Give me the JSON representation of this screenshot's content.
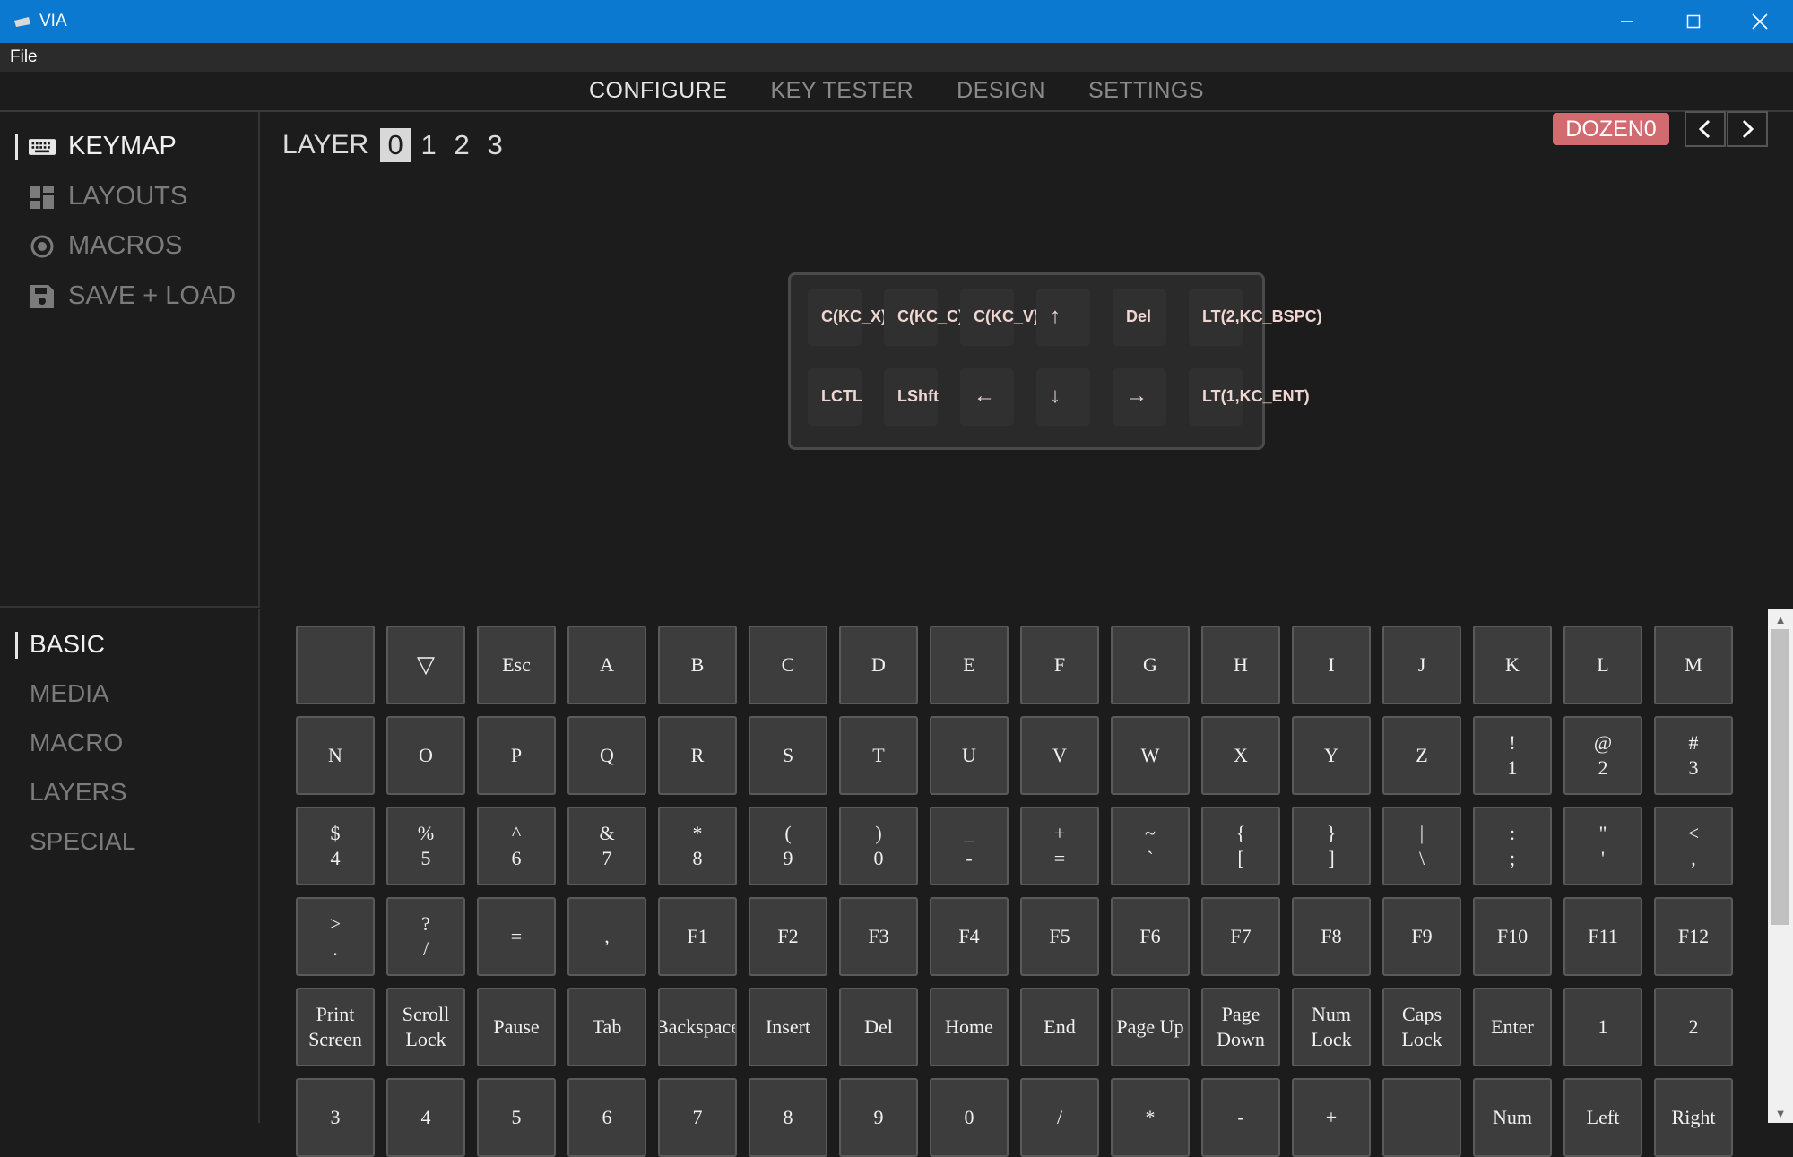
{
  "window": {
    "title": "VIA",
    "minimize": "—",
    "maximize": "☐",
    "close": "✕"
  },
  "menu": {
    "file": "File"
  },
  "nav": {
    "tabs": [
      "CONFIGURE",
      "KEY TESTER",
      "DESIGN",
      "SETTINGS"
    ],
    "active": "CONFIGURE"
  },
  "sidebar": {
    "items": [
      {
        "label": "KEYMAP",
        "icon": "keyboard-icon",
        "active": true
      },
      {
        "label": "LAYOUTS",
        "icon": "grid-icon",
        "active": false
      },
      {
        "label": "MACROS",
        "icon": "circle-dot-icon",
        "active": false
      },
      {
        "label": "SAVE + LOAD",
        "icon": "floppy-disk-icon",
        "active": false
      }
    ]
  },
  "layers": {
    "label": "LAYER",
    "numbers": [
      "0",
      "1",
      "2",
      "3"
    ],
    "selected": "0"
  },
  "device": {
    "name": "DOZEN0",
    "prev": "<",
    "next": ">",
    "badge_color": "#d26b70"
  },
  "keyboard_keys": [
    [
      "C(KC_X)",
      "C(KC_C)",
      "C(KC_V)",
      "↑",
      "Del",
      "LT(2,KC_BSPC)"
    ],
    [
      "LCTL",
      "LShft",
      "←",
      "↓",
      "→",
      "LT(1,KC_ENT)"
    ]
  ],
  "categories": {
    "items": [
      "BASIC",
      "MEDIA",
      "MACRO",
      "LAYERS",
      "SPECIAL"
    ],
    "active": "BASIC"
  },
  "key_grid": [
    [
      "",
      "▽",
      "Esc",
      "A",
      "B",
      "C",
      "D",
      "E",
      "F",
      "G",
      "H",
      "I",
      "J",
      "K",
      "L",
      "M"
    ],
    [
      "N",
      "O",
      "P",
      "Q",
      "R",
      "S",
      "T",
      "U",
      "V",
      "W",
      "X",
      "Y",
      "Z",
      "!\n1",
      "@\n2",
      "#\n3"
    ],
    [
      "$\n4",
      "%\n5",
      "^\n6",
      "&\n7",
      "*\n8",
      "(\n9",
      ")\n0",
      "_\n-",
      "+\n=",
      "~\n`",
      "{\n[",
      "}\n]",
      "|\n\\",
      ":\n;",
      "\"\n'",
      "<\n,"
    ],
    [
      ">\n.",
      "?\n/",
      "=",
      ",",
      "F1",
      "F2",
      "F3",
      "F4",
      "F5",
      "F6",
      "F7",
      "F8",
      "F9",
      "F10",
      "F11",
      "F12"
    ],
    [
      "Print\nScreen",
      "Scroll\nLock",
      "Pause",
      "Tab",
      "Backspace",
      "Insert",
      "Del",
      "Home",
      "End",
      "Page Up",
      "Page\nDown",
      "Num\nLock",
      "Caps\nLock",
      "Enter",
      "1",
      "2"
    ],
    [
      "3",
      "4",
      "5",
      "6",
      "7",
      "8",
      "9",
      "0",
      "/",
      "*",
      "-",
      "+",
      "",
      "Num",
      "Left",
      "Right"
    ]
  ]
}
